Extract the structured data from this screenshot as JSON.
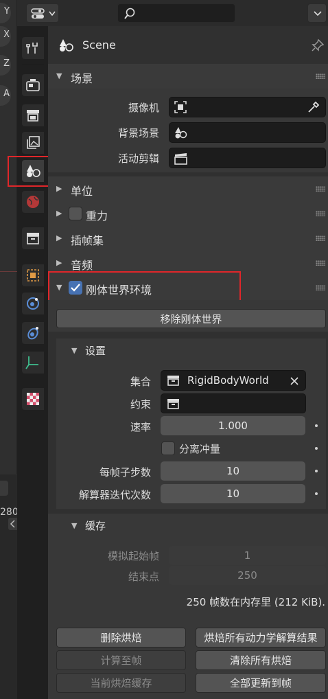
{
  "viewport": {
    "axis_labels": [
      "Y",
      "X",
      "Z",
      "A"
    ],
    "frame_number": "280"
  },
  "header": {
    "editor_type_icon": "properties-editor-icon",
    "search_placeholder": ""
  },
  "tabs": [
    {
      "name": "tool",
      "icon": "wrench-screwdriver-icon"
    },
    {
      "name": "render",
      "icon": "render-camera-icon"
    },
    {
      "name": "output",
      "icon": "printer-icon"
    },
    {
      "name": "view-layer",
      "icon": "image-stack-icon"
    },
    {
      "name": "scene",
      "icon": "scene-icon",
      "active": true
    },
    {
      "name": "world",
      "icon": "world-icon"
    },
    {
      "name": "collection",
      "icon": "collection-box-icon"
    },
    {
      "name": "object",
      "icon": "object-square-icon"
    },
    {
      "name": "modifiers",
      "icon": "blue-circle-icon"
    },
    {
      "name": "particles",
      "icon": "physics-orbit-icon"
    },
    {
      "name": "constraints",
      "icon": "axes-icon"
    },
    {
      "name": "texture",
      "icon": "checker-icon"
    }
  ],
  "context": {
    "title": "Scene"
  },
  "panels": {
    "scene": {
      "title": "场景",
      "camera_label": "摄像机",
      "background_label": "背景场景",
      "clip_label": "活动剪辑"
    },
    "units": {
      "title": "单位"
    },
    "gravity": {
      "title": "重力",
      "checked": false
    },
    "keying_sets": {
      "title": "插帧集"
    },
    "audio": {
      "title": "音频"
    },
    "rigid_body_world": {
      "title": "刚体世界环境",
      "checked": true,
      "remove_button": "移除刚体世界"
    }
  },
  "settings": {
    "title": "设置",
    "collection_label": "集合",
    "collection_value": "RigidBodyWorld",
    "constraints_label": "约束",
    "speed_label": "速率",
    "speed_value": "1.000",
    "split_impulse_label": "分离冲量",
    "split_impulse_checked": false,
    "substeps_label": "每帧子步数",
    "substeps_value": "10",
    "solver_iter_label": "解算器迭代次数",
    "solver_iter_value": "10"
  },
  "cache": {
    "title": "缓存",
    "sim_start_label": "模拟起始帧",
    "sim_start_value": "1",
    "end_label": "结束点",
    "end_value": "250",
    "memory_info": "250 帧数在内存里 (212 KiB).",
    "delete_bake": "删除烘焙",
    "bake_all": "烘焙所有动力学解算结果",
    "calc_to_frame": "计算至帧",
    "free_all_bakes": "清除所有烘焙",
    "current_cache_to_bake": "当前烘焙缓存",
    "update_all_to_frame": "全部更新到帧"
  },
  "colors": {
    "highlight_box": "#e0262a",
    "checkbox_on": "#4772b3",
    "panel_bg": "#303030"
  }
}
